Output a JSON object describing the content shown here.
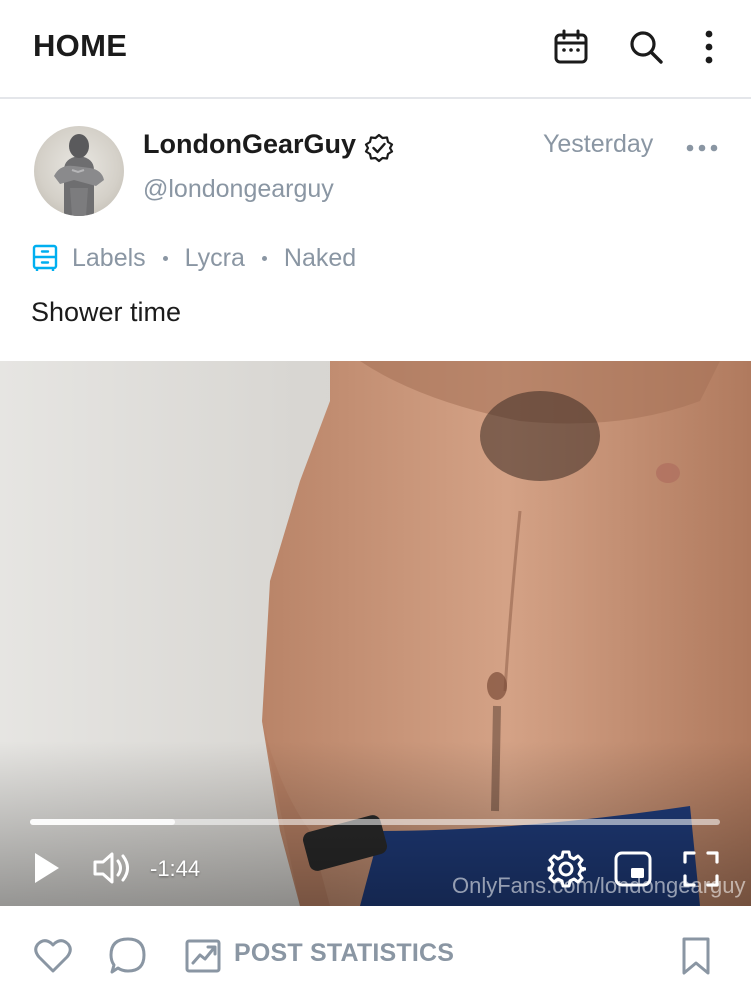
{
  "header": {
    "title": "HOME",
    "icons": [
      "calendar-icon",
      "search-icon",
      "more-vertical-icon"
    ]
  },
  "post": {
    "author_name": "LondonGearGuy",
    "author_handle": "@londongearguy",
    "timestamp": "Yesterday",
    "labels_heading": "Labels",
    "labels": [
      "Lycra",
      "Naked"
    ],
    "caption": "Shower time"
  },
  "video": {
    "time_remaining": "-1:44",
    "progress_fraction": 0.21,
    "watermark": "OnlyFans.com/londongearguy"
  },
  "footer": {
    "post_statistics_label": "POST STATISTICS"
  },
  "colors": {
    "accent": "#00aff0",
    "muted_text": "#8a96a3",
    "primary_text": "#1b1b1b"
  }
}
